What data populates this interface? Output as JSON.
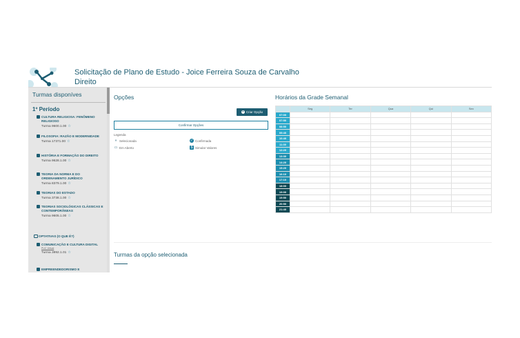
{
  "header": {
    "title": "Solicitação de Plano de Estudo - Joice Ferreira Souza de Carvalho",
    "course": "Direito"
  },
  "sidebar": {
    "title": "Turmas disponíves",
    "period": "1º Período",
    "courses": [
      {
        "name": "CULTURA RELIGIOSA: FENÔMENO RELIGIOSO",
        "turma": "Turma 9600.1.00"
      },
      {
        "name": "FILOSOFIA: RAZÃO E MODERNIDADE",
        "turma": "Turma 17371.00"
      },
      {
        "name": "HISTÓRIA E FORMAÇÃO DO DIREITO",
        "turma": "Turma 9628.1.00"
      },
      {
        "name": "TEORIA DA NORMA E DO ORDENAMENTO JURÍDICO",
        "turma": "Turma 8379.1.00"
      },
      {
        "name": "TEORIAS DO ESTADO",
        "turma": "Turma 3738.1.00"
      },
      {
        "name": "TEORIAS SOCIOLÓGICAS CLÁSSICAS E CONTEMPORÂNEAS",
        "turma": "Turma 9605.1.00"
      }
    ],
    "optativas_label": "OPTATIVAS (O QUE É?)",
    "optativas": [
      {
        "name": "COMUNICAÇÃO E CULTURA DIGITAL",
        "sub": "PUC Virtual",
        "turma": "Turma 3992.1.01"
      },
      {
        "name": "EMPREENDEDORISMO E",
        "turma": ""
      }
    ]
  },
  "opcoes": {
    "title": "Opções",
    "criar_label": "Criar Opção",
    "confirmar_label": "Confirmar Opções",
    "legenda_title": "Legenda",
    "legenda": {
      "selecionada": "Selecionada",
      "confirmada": "Confirmada",
      "em_aberto": "Em Aberto",
      "simular": "Simular Valores"
    }
  },
  "grade": {
    "title": "Horários da Grade Semanal",
    "days": [
      "Seg",
      "Ter",
      "Qua",
      "Qui",
      "Sex"
    ],
    "times": [
      "07:00",
      "07:50",
      "08:50",
      "09:40",
      "10:40",
      "11:30",
      "12:20",
      "13:30",
      "14:20",
      "15:20",
      "16:10",
      "17:10",
      "18:00",
      "19:00",
      "19:50",
      "20:50",
      "21:40"
    ],
    "colors": {
      "morning": "#29a9cc",
      "afternoon": "#1d8fb0",
      "night": "#0f4a55"
    }
  },
  "turmas_opcao": {
    "title": "Turmas da opção selecionada"
  }
}
